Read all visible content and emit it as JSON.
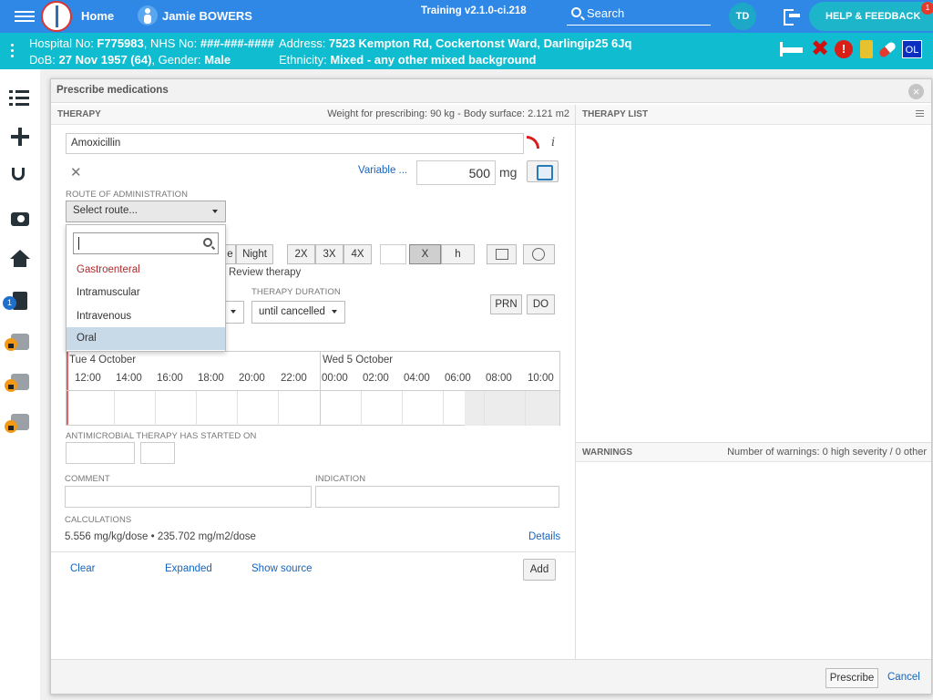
{
  "header": {
    "home_label": "Home",
    "patient_name": "Jamie BOWERS",
    "version": "Training v2.1.0-ci.218",
    "search_label": "Search",
    "user_initials": "TD",
    "help_label": "HELP & FEEDBACK",
    "help_badge": "1"
  },
  "patient_bar": {
    "hospital_label": "Hospital No: ",
    "hospital_no": "F775983",
    "nhs_label": ", NHS No: ",
    "nhs_no": "###-###-####",
    "dob_label": "DoB: ",
    "dob": "27 Nov 1957 (64)",
    "gender_label": ", Gender: ",
    "gender": "Male",
    "address_label": "Address: ",
    "address": "7523 Kempton Rd, Cockertonst Ward, Darlingip25 6Jq",
    "ethnicity_label": "Ethnicity: ",
    "ethnicity": "Mixed - any other mixed background",
    "icons": [
      "bed-icon",
      "allergy-x-icon",
      "alert-icon",
      "bottle-icon",
      "pill-icon",
      "ol-badge"
    ],
    "ol_label": "OL"
  },
  "nav": {
    "badge_count": "1"
  },
  "modal": {
    "title": "Prescribe medications",
    "close": "×",
    "therapy_title": "THERAPY",
    "weight_text": "Weight for prescribing: 90 kg - Body surface: 2.121 m2",
    "therapy_list_title": "THERAPY LIST",
    "medication": "Amoxicillin",
    "clear_x": "✕",
    "variable_link": "Variable ...",
    "dose_value": "500",
    "dose_unit": "mg",
    "route_label": "ROUTE OF ADMINISTRATION",
    "route_placeholder": "Select route...",
    "dose_times": [
      "e",
      "Night"
    ],
    "frequencies": [
      "2X",
      "3X",
      "4X"
    ],
    "freq_units": [
      "X",
      "h"
    ],
    "review_therapy": "Review therapy",
    "therapy_duration_label": "THERAPY DURATION",
    "therapy_duration": "until cancelled",
    "prn": "PRN",
    "do": "DO",
    "timeline": {
      "day1": "Tue 4 October",
      "day2": "Wed 5 October",
      "hours": [
        "12:00",
        "14:00",
        "16:00",
        "18:00",
        "20:00",
        "22:00",
        "00:00",
        "02:00",
        "04:00",
        "06:00",
        "08:00",
        "10:00"
      ]
    },
    "antimicrobial_label": "ANTIMICROBIAL THERAPY HAS STARTED ON",
    "comment_label": "COMMENT",
    "indication_label": "INDICATION",
    "calculations_label": "CALCULATIONS",
    "calculations_values": "5.556 mg/kg/dose • 235.702 mg/m2/dose",
    "details_link": "Details",
    "clear_link": "Clear",
    "expanded_link": "Expanded",
    "show_source_link": "Show source",
    "add_button": "Add",
    "warnings_title": "WARNINGS",
    "warnings_count": "Number of warnings: 0 high severity / 0 other",
    "prescribe_button": "Prescribe",
    "cancel_link": "Cancel"
  },
  "route_dropdown": {
    "search_value": "",
    "options": [
      "Gastroenteral",
      "Intramuscular",
      "Intravenous",
      "Oral"
    ],
    "highlighted": "Oral"
  },
  "colors": {
    "header_blue": "#2f88e6",
    "patient_bar_teal": "#10bcd0",
    "link_blue": "#1565c0",
    "highlight": "#c8d9e8"
  }
}
